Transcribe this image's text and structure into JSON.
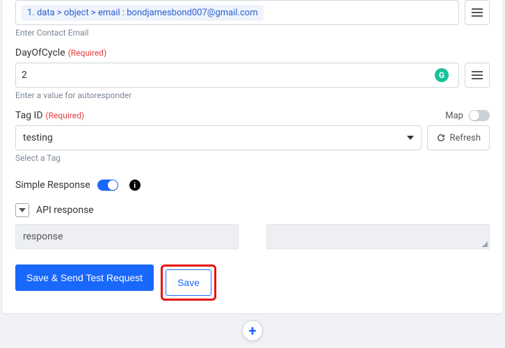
{
  "email_field": {
    "pill": "1. data > object > email : bondjamesbond007@gmail.com",
    "hint": "Enter Contact Email"
  },
  "day_of_cycle": {
    "label": "DayOfCycle",
    "required": "(Required)",
    "value": "2",
    "hint": "Enter a value for autoresponder"
  },
  "tag_id": {
    "label": "Tag ID",
    "required": "(Required)",
    "map_label": "Map",
    "value": "testing",
    "refresh": "Refresh",
    "hint": "Select a Tag"
  },
  "simple_response": {
    "label": "Simple Response"
  },
  "api_response": {
    "label": "API response",
    "left_value": "response"
  },
  "buttons": {
    "save_send": "Save & Send Test Request",
    "save": "Save"
  },
  "grammarly": "G"
}
